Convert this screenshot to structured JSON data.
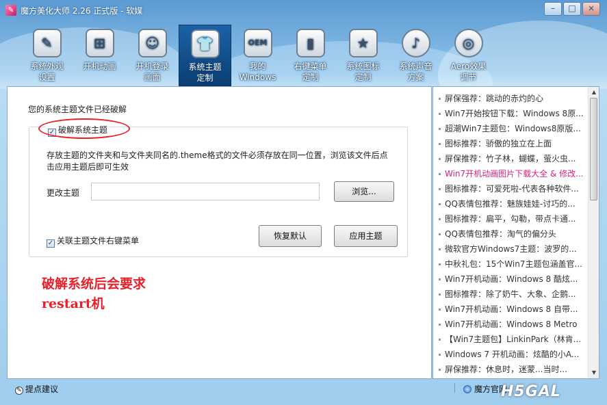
{
  "window": {
    "title": "魔方美化大师 2.26 正式版 - 软媒",
    "min_label": "–",
    "max_label": "□",
    "close_label": "×"
  },
  "toolbar": {
    "items": [
      {
        "label": "系统外观\n设置",
        "icon": "brush-icon",
        "glyph": "✎"
      },
      {
        "label": "开机动画",
        "icon": "windows-logo-icon",
        "glyph": "⊞"
      },
      {
        "label": "开机登录\n画面",
        "icon": "user-login-icon",
        "glyph": "☺"
      },
      {
        "label": "系统主题\n定制",
        "icon": "tshirt-icon",
        "glyph": "👕",
        "active": true
      },
      {
        "label": "我的\nWindows",
        "icon": "oem-icon",
        "glyph": "OEM"
      },
      {
        "label": "右键菜单\n定制",
        "icon": "context-menu-icon",
        "glyph": "▮"
      },
      {
        "label": "系统图标\n定制",
        "icon": "star-icon",
        "glyph": "★"
      },
      {
        "label": "系统声音\n方案",
        "icon": "music-note-icon",
        "glyph": "♪"
      },
      {
        "label": "Aero效果\n调节",
        "icon": "aero-target-icon",
        "glyph": "◎"
      }
    ]
  },
  "main": {
    "status": "您的系统主题文件已经破解",
    "crack_checkbox": {
      "label": "破解系统主题",
      "checked": true
    },
    "description": "存放主题的文件夹和与文件夹同名的.theme格式的文件必须存放在同一位置，浏览该文件后点击应用主题后即可生效",
    "change_label": "更改主题",
    "theme_input": {
      "value": "",
      "placeholder": ""
    },
    "browse_label": "浏览...",
    "assoc_checkbox": {
      "label": "关联主题文件右键菜单",
      "checked": true
    },
    "restore_label": "恢复默认",
    "apply_label": "应用主题",
    "annotation_line1": "破解系统后会要求",
    "annotation_line2": "restart机"
  },
  "news": {
    "items": [
      "屏保强荐：跳动的赤灼的心",
      "Win7开始按钮下载：Windows 8原...",
      "超潮Win7主题包：Windows8原版...",
      "图标推荐：骄傲的独立在上面",
      "屏保推荐：竹子林，蝴蝶，萤火虫...",
      "Win7开机动画图片下载大全 & 修改...",
      "图标推荐：可爱死啦-代表各种软件...",
      "QQ表情包推荐：魅族娃娃-讨巧的...",
      "图标推荐：扁平，勾勒，带点卡通...",
      "QQ表情包推荐：淘气的偏分头",
      "微软官方Windows7主题：波罗的...",
      "中秋礼包：15个Win7主题包涵盖官...",
      "Win7开机动画：Windows 8 酷炫...",
      "图标推荐：除了奶牛、大象、企鹅...",
      "Win7开机动画：Windows 8 自带...",
      "Win7开机动画：Windows 8 Metro",
      "【Win7主题包】LinkinPark（林肯...",
      "Windows 7 开机动画：炫酷的小A...",
      "屏保推荐：休息时，迷蒙...当时..."
    ],
    "highlight_index": 5,
    "scroll_up": "▲",
    "scroll_down": "▼"
  },
  "bottom": {
    "feedback": "提点建议",
    "official_site": "魔方官网",
    "watermark": "H5GAL"
  },
  "colors": {
    "accent_red": "#e8202a",
    "highlight_pink": "#d6237f",
    "active_tab": "#0b3e74"
  }
}
